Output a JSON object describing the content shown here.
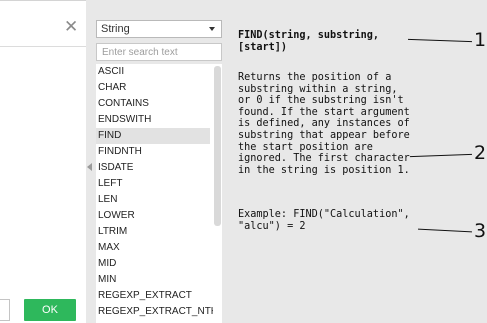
{
  "editor": {
    "close_glyph": "✕",
    "ok_label": "OK"
  },
  "reference": {
    "category_value": "String",
    "search_placeholder": "Enter search text",
    "functions": [
      "ASCII",
      "CHAR",
      "CONTAINS",
      "ENDSWITH",
      "FIND",
      "FINDNTH",
      "ISDATE",
      "LEFT",
      "LEN",
      "LOWER",
      "LTRIM",
      "MAX",
      "MID",
      "MIN",
      "REGEXP_EXTRACT",
      "REGEXP_EXTRACT_NTH"
    ],
    "selected_index": 4,
    "signature": "FIND(string, substring,\n[start])",
    "description": "Returns the position of a\nsubstring within a string,\nor 0 if the substring isn't\nfound. If the start argument\nis defined, any instances of\nsubstring that appear before\nthe start position are\nignored. The first character\nin the string is position 1.",
    "example": "Example: FIND(\"Calculation\",\n\"alcu\") = 2"
  },
  "callouts": [
    "1",
    "2",
    "3"
  ]
}
